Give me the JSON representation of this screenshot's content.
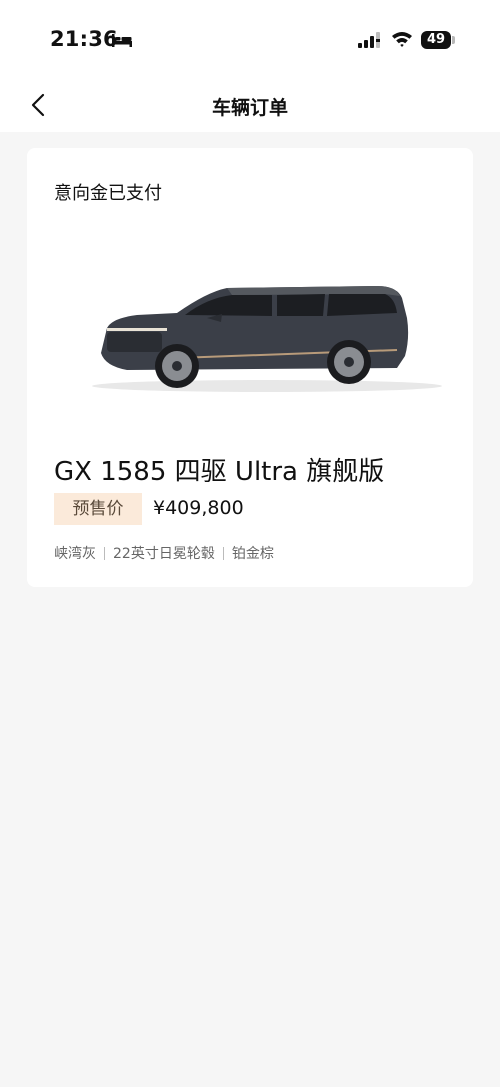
{
  "status_bar": {
    "time": "21:36",
    "battery": "49",
    "icons": [
      "bed-icon",
      "signal-icon",
      "wifi-icon",
      "battery-icon"
    ]
  },
  "nav": {
    "title": "车辆订单",
    "back_icon": "chevron-left-icon"
  },
  "order": {
    "status": "意向金已支付",
    "model": "GX 1585 四驱 Ultra 旗舰版",
    "price_tag": "预售价",
    "price": "¥409,800",
    "options": [
      "峡湾灰",
      "22英寸日冕轮毂",
      "铂金棕"
    ]
  },
  "colors": {
    "background": "#f6f6f6",
    "card": "#ffffff",
    "price_tag_bg": "#fbeada",
    "car_body": "#3b3f48"
  }
}
